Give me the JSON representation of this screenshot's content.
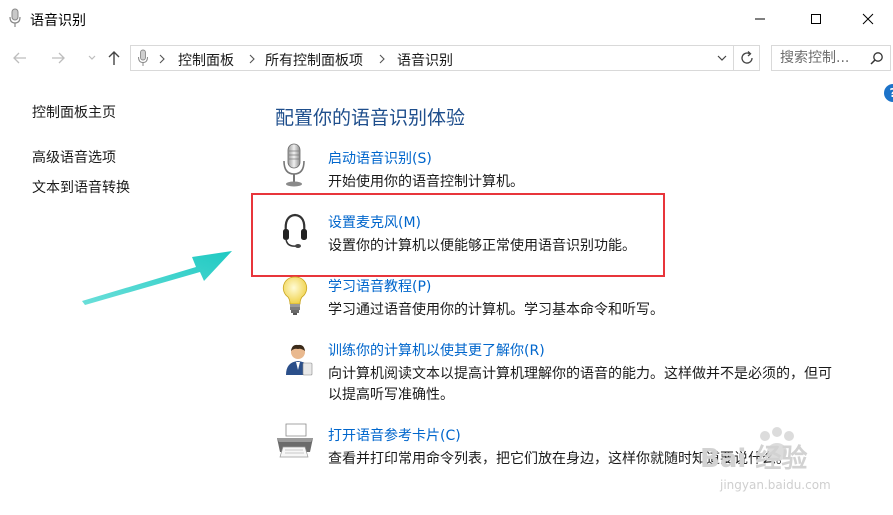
{
  "window": {
    "title": "语音识别"
  },
  "nav": {
    "breadcrumbs": [
      "控制面板",
      "所有控制面板项",
      "语音识别"
    ],
    "search_placeholder": "搜索控制..."
  },
  "left_nav": {
    "home": "控制面板主页",
    "links": [
      "高级语音选项",
      "文本到语音转换"
    ]
  },
  "main": {
    "title": "配置你的语音识别体验",
    "items": [
      {
        "icon": "microphone-icon",
        "link": "启动语音识别(S)",
        "desc": [
          "开始使用你的语音控制计算机。"
        ]
      },
      {
        "icon": "headset-icon",
        "link": "设置麦克风(M)",
        "desc": [
          "设置你的计算机以便能够正常使用语音识别功能。"
        ]
      },
      {
        "icon": "lightbulb-icon",
        "link": "学习语音教程(P)",
        "desc": [
          "学习通过语音使用你的计算机。学习基本命令和听写。"
        ]
      },
      {
        "icon": "user-train-icon",
        "link": "训练你的计算机以使其更了解你(R)",
        "desc": [
          "向计算机阅读文本以提高计算机理解你的语音的能力。这样做并不是必须的，但可",
          "以提高听写准确性。"
        ]
      },
      {
        "icon": "printer-icon",
        "link": "打开语音参考卡片(C)",
        "desc": [
          "查看并打印常用命令列表，把它们放在身边，这样你就随时知道要说什么。"
        ]
      }
    ]
  },
  "watermark": {
    "brand": "Bai 经验",
    "url": "jingyan.baidu.com"
  },
  "colors": {
    "link": "#0066cc",
    "title": "#1e4e8c",
    "highlight": "#e8353b",
    "arrow": "#2ad1c9"
  }
}
